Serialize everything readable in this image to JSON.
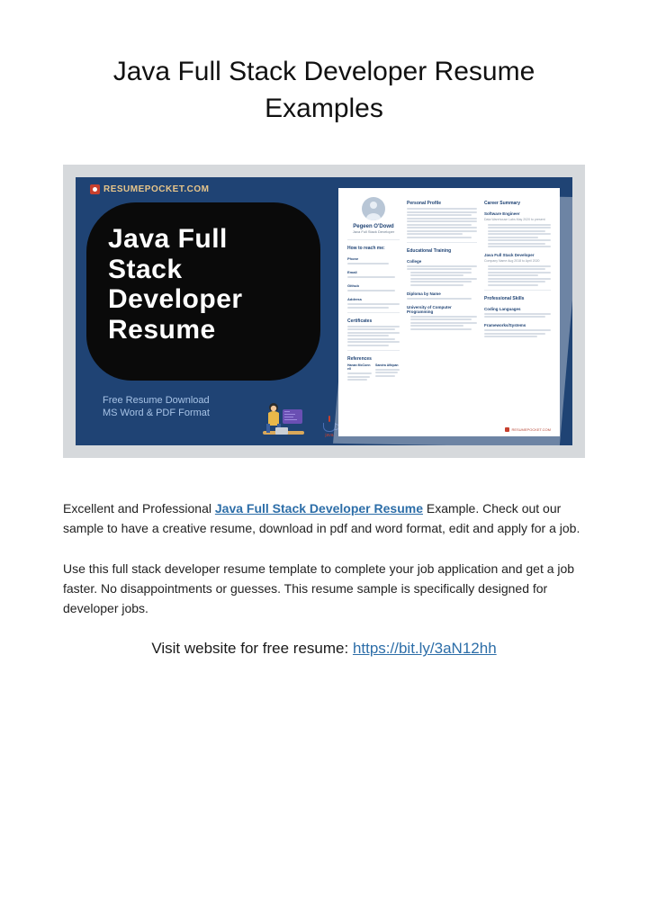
{
  "title": "Java Full Stack Developer Resume Examples",
  "hero": {
    "brand": "RESUMEPOCKET.COM",
    "blob_line1": "Java Full",
    "blob_line2": "Stack",
    "blob_line3": "Developer",
    "blob_line4": "Resume",
    "sub1": "Free Resume Download",
    "sub2": "MS Word & PDF Format",
    "java_label": "java"
  },
  "resume": {
    "name": "Pegeen O'Dowd",
    "role": "Java Full Stack Developer",
    "col1": {
      "reach_h": "How to reach me:",
      "phone_h": "Phone",
      "email_h": "Email",
      "github_h": "Github",
      "address_h": "Address",
      "cert_h": "Certificates",
      "ref_h": "References",
      "ref1_name": "Hanan McConnell",
      "ref2_name": "Sandra Afkipan"
    },
    "col2": {
      "profile_h": "Personal Profile",
      "edu_h": "Educational Training",
      "college_h": "College",
      "diploma_h": "Diploma by Name",
      "univ_h": "University of Computer Programming"
    },
    "col3": {
      "summary_h": "Career Summary",
      "job1_h": "Software Engineer",
      "job1_dates": "Data Warehouse Labs May 2020 to present",
      "job2_h": "Java Full Stack Developer",
      "job2_dates": "Company Name Aug 2018 to April 2020",
      "skills_h": "Professional Skills",
      "lang_h": "Coding Languages",
      "frame_h": "Frameworks/Systems"
    },
    "footer_brand": "RESUMEPOCKET.COM"
  },
  "para1_a": "Excellent and Professional ",
  "para1_link": "Java Full Stack Developer Resume",
  "para1_b": " Example. Check out our sample to have a creative resume, download in pdf and word format, edit and apply for a job.",
  "para2": "Use this full stack developer resume template to complete your job application and get a job faster. No disappointments or guesses. This resume sample is specifically designed for developer jobs.",
  "cta_text": "Visit website for free resume: ",
  "cta_url": "https://bit.ly/3aN12hh"
}
